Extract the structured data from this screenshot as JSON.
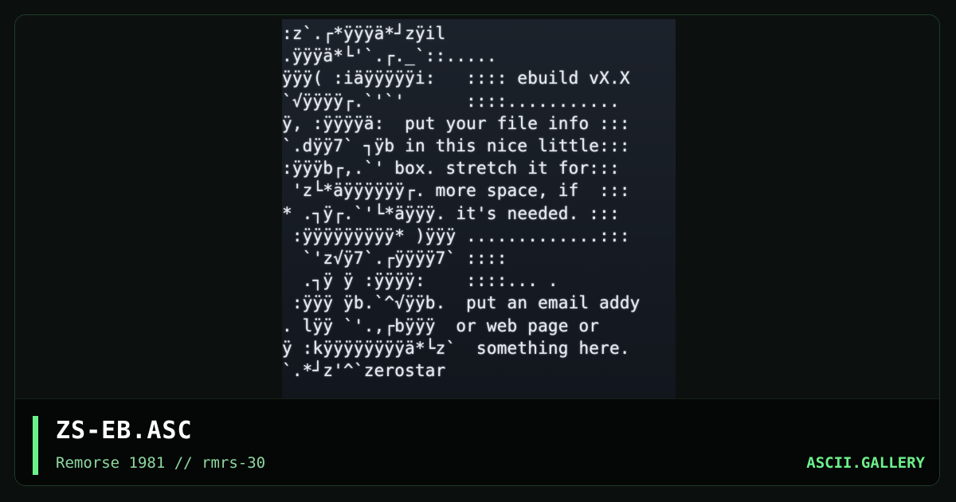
{
  "art": {
    "lines": [
      ":z`.┌*ÿÿÿä*┘zÿil",
      ".ÿÿÿä*└'`.┌._`::.....",
      "ÿÿÿ( :iäÿÿÿÿÿi:   :::: ebuild vX.X",
      "`√ÿÿÿÿ┌.`'`'      ::::...........",
      "ÿ, :ÿÿÿÿä:  put your file info :::",
      "`.dÿÿ7` ┐ÿb in this nice little:::",
      ":ÿÿÿb┌,.`' box. stretch it for:::",
      " 'z└*äÿÿÿÿÿÿ┌. more space, if  :::",
      "* .┐ÿ┌.`'└*äÿÿÿ. it's needed. :::",
      " :ÿÿÿÿÿÿÿÿÿ* )ÿÿÿ .............:::",
      "  `'z√ÿ7`.┌ÿÿÿÿ7` ::::",
      "  .┐ÿ ÿ :ÿÿÿÿ:    ::::... .",
      " :ÿÿÿ ÿb.`^√ÿÿb.  put an email addy",
      ". lÿÿ `'.,┌bÿÿÿ  or web page or",
      "ÿ :kÿÿÿÿÿÿÿÿä*└z`  something here.",
      "`.*┘z'^`zerostar"
    ]
  },
  "footer": {
    "title": "ZS-EB.ASC",
    "subtitle": "Remorse 1981 // rmrs-30",
    "brand": "ASCII.GALLERY"
  },
  "colors": {
    "accent": "#6cf08a",
    "subtitle": "#8fd9a0",
    "background": "#0b0f0e"
  }
}
